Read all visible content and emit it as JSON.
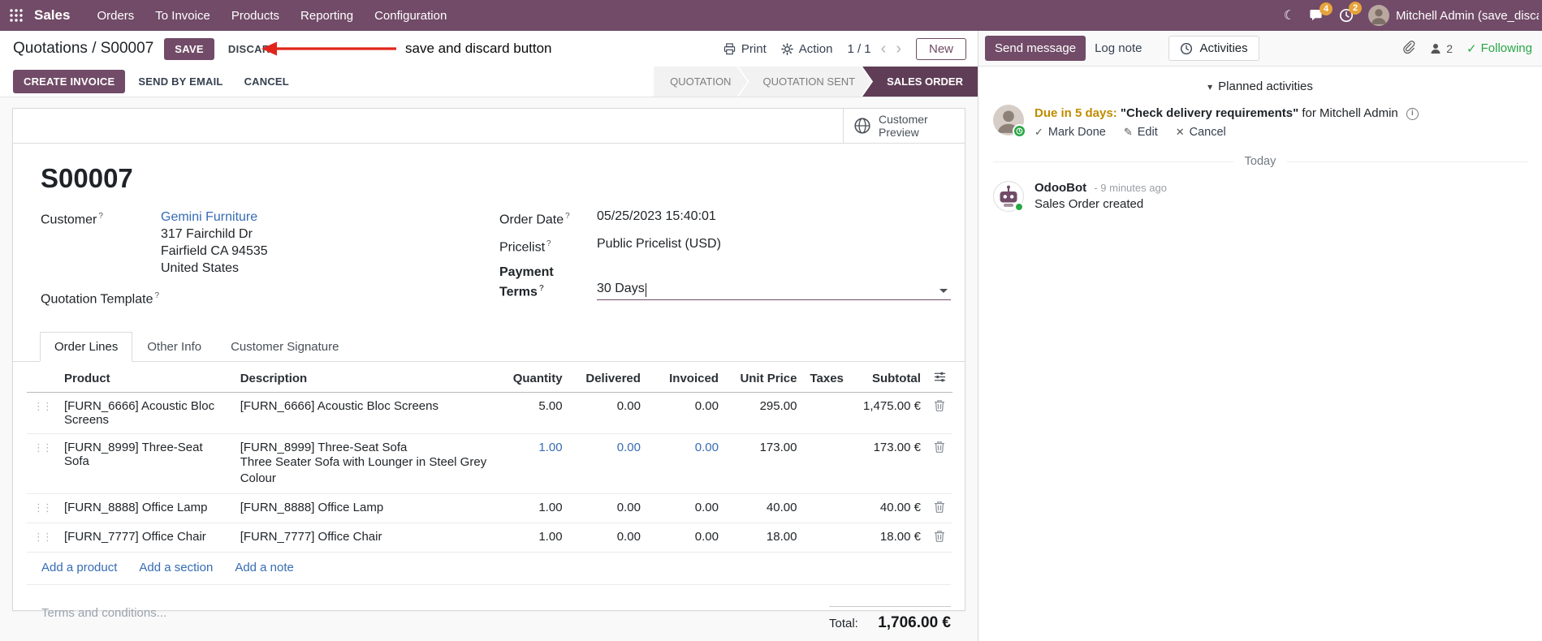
{
  "colors": {
    "brand": "#714B67",
    "active_step": "#5f3d56",
    "link": "#366CB3",
    "following_green": "#28a745",
    "due_warning": "#bf8c00",
    "annotation_red": "#e1251b",
    "badge_orange": "#e7a33b"
  },
  "nav": {
    "brand": "Sales",
    "menus": [
      "Orders",
      "To Invoice",
      "Products",
      "Reporting",
      "Configuration"
    ],
    "messages_badge": "4",
    "activities_badge": "2",
    "user": "Mitchell Admin (save_discar"
  },
  "breadcrumb": {
    "parent": "Quotations",
    "separator": "/",
    "current": "S00007",
    "save": "SAVE",
    "discard": "DISCARD"
  },
  "annotation": {
    "text": "save and discard button"
  },
  "controls": {
    "print": "Print",
    "action": "Action",
    "pager": "1 / 1",
    "prev": "‹",
    "next": "›",
    "new_label": "New"
  },
  "statusbar": {
    "create_invoice": "CREATE INVOICE",
    "send_by_email": "SEND BY EMAIL",
    "cancel": "CANCEL",
    "steps": [
      {
        "label": "QUOTATION",
        "active": false
      },
      {
        "label": "QUOTATION SENT",
        "active": false
      },
      {
        "label": "SALES ORDER",
        "active": true
      }
    ]
  },
  "sheet": {
    "preview_button": "Customer Preview",
    "title": "S00007",
    "customer": {
      "label": "Customer",
      "help": "?",
      "value": "Gemini Furniture",
      "address": [
        "317 Fairchild Dr",
        "Fairfield CA 94535",
        "United States"
      ]
    },
    "quotation_template": {
      "label": "Quotation Template",
      "help": "?",
      "value": ""
    },
    "order_date": {
      "label": "Order Date",
      "help": "?",
      "value": "05/25/2023 15:40:01"
    },
    "pricelist": {
      "label": "Pricelist",
      "help": "?",
      "value": "Public Pricelist (USD)"
    },
    "payment_terms": {
      "label": "Payment Terms",
      "help": "?",
      "value": "30 Days"
    },
    "tabs": [
      {
        "label": "Order Lines",
        "active": true
      },
      {
        "label": "Other Info",
        "active": false
      },
      {
        "label": "Customer Signature",
        "active": false
      }
    ],
    "table": {
      "columns": [
        "Product",
        "Description",
        "Quantity",
        "Delivered",
        "Invoiced",
        "Unit Price",
        "Taxes",
        "Subtotal"
      ],
      "rows": [
        {
          "product": "[FURN_6666] Acoustic Bloc Screens",
          "description": "[FURN_6666] Acoustic Bloc Screens",
          "description2": "",
          "quantity": "5.00",
          "delivered": "0.00",
          "invoiced": "0.00",
          "unit_price": "295.00",
          "taxes": "",
          "subtotal": "1,475.00 €"
        },
        {
          "product": "[FURN_8999] Three-Seat Sofa",
          "description": "[FURN_8999] Three-Seat Sofa",
          "description2": "Three Seater Sofa with Lounger in Steel Grey Colour",
          "quantity": "1.00",
          "delivered": "0.00",
          "invoiced": "0.00",
          "unit_price": "173.00",
          "taxes": "",
          "subtotal": "173.00 €"
        },
        {
          "product": "[FURN_8888] Office Lamp",
          "description": "[FURN_8888] Office Lamp",
          "description2": "",
          "quantity": "1.00",
          "delivered": "0.00",
          "invoiced": "0.00",
          "unit_price": "40.00",
          "taxes": "",
          "subtotal": "40.00 €"
        },
        {
          "product": "[FURN_7777] Office Chair",
          "description": "[FURN_7777] Office Chair",
          "description2": "",
          "quantity": "1.00",
          "delivered": "0.00",
          "invoiced": "0.00",
          "unit_price": "18.00",
          "taxes": "",
          "subtotal": "18.00 €"
        }
      ],
      "footer_links": [
        "Add a product",
        "Add a section",
        "Add a note"
      ]
    },
    "terms_placeholder": "Terms and conditions...",
    "total": {
      "label": "Total:",
      "value": "1,706.00 €"
    }
  },
  "chatter": {
    "send_message": "Send message",
    "log_note": "Log note",
    "activities_tab": "Activities",
    "followers_count": "2",
    "following": "Following",
    "planned_header": "Planned activities",
    "activity": {
      "due": "Due in 5 days:",
      "title": "\"Check delivery requirements\"",
      "assignee": "for Mitchell Admin",
      "mark_done": "Mark Done",
      "edit": "Edit",
      "cancel": "Cancel"
    },
    "today": "Today",
    "message": {
      "author": "OdooBot",
      "time": "- 9 minutes ago",
      "body": "Sales Order created"
    }
  },
  "icons": {
    "caret_down": "▾",
    "check": "✓",
    "pencil": "✎",
    "cross": "✕",
    "drag": "⋮⋮",
    "moon": "☾",
    "info": "i"
  }
}
